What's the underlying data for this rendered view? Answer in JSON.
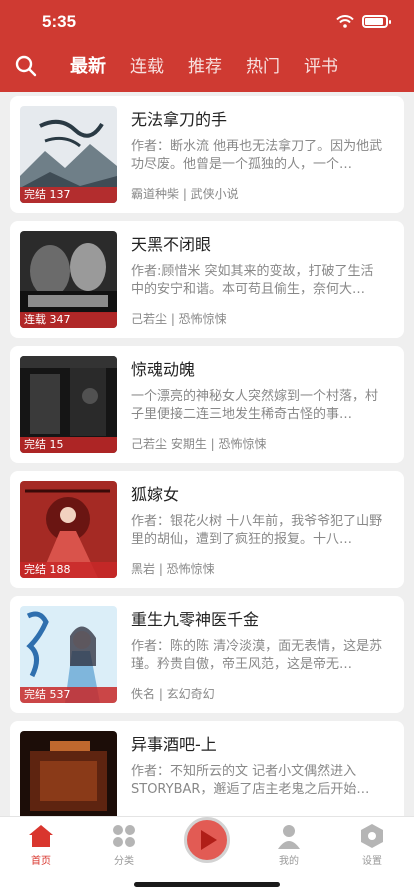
{
  "status": {
    "time": "5:35"
  },
  "tabs": [
    "最新",
    "连载",
    "推荐",
    "热门",
    "评书"
  ],
  "books": [
    {
      "title": "无法拿刀的手",
      "desc": "作者：断水流 他再也无法拿刀了。因为他武功尽废。他曾是一个孤独的人，一个…",
      "meta": "霸道种柴 | 武侠小说",
      "badge": "完结 137",
      "color1": "#e8ecef",
      "color2": "#5d6e78"
    },
    {
      "title": "天黑不闭眼",
      "desc": "作者:顾惜米 突如其来的变故，打破了生活中的安宁和谐。本可苟且偷生，奈何大…",
      "meta": "己若尘 | 恐怖惊悚",
      "badge": "连载 347",
      "color1": "#4a4a4a",
      "color2": "#111111"
    },
    {
      "title": "惊魂动魄",
      "desc": "一个漂亮的神秘女人突然嫁到一个村落，村子里便接二连三地发生稀奇古怪的事…",
      "meta": "己若尘 安期生 | 恐怖惊悚",
      "badge": "完结 15",
      "color1": "#3a3a3a",
      "color2": "#0d0d0d"
    },
    {
      "title": "狐嫁女",
      "desc": "作者：银花火树 十八年前，我爷爷犯了山野里的胡仙，遭到了疯狂的报复。十八…",
      "meta": "黑岩 | 恐怖惊悚",
      "badge": "完结 188",
      "color1": "#b23a33",
      "color2": "#5a1010"
    },
    {
      "title": "重生九零神医千金",
      "desc": "作者：陈的陈 清冷淡漠，面无表情，这是苏瑾。矜贵自傲，帝王风范，这是帝无…",
      "meta": "佚名 | 玄幻奇幻",
      "badge": "完结 537",
      "color1": "#bfe0f2",
      "color2": "#6fa6cf"
    },
    {
      "title": "异事酒吧-上",
      "desc": "作者：不知所云的文 记者小文偶然进入STORYBAR，邂逅了店主老鬼之后开始…",
      "meta": "",
      "badge": "",
      "color1": "#7a2a10",
      "color2": "#1a0a05"
    }
  ],
  "tabbar": [
    {
      "label": "首页",
      "icon": "home-icon"
    },
    {
      "label": "分类",
      "icon": "grid-icon"
    },
    {
      "label": "",
      "icon": "play-logo-icon"
    },
    {
      "label": "我的",
      "icon": "user-icon"
    },
    {
      "label": "设置",
      "icon": "settings-icon"
    }
  ],
  "colors": {
    "brand": "#cf3a32",
    "active_tab": "#d9362e"
  }
}
